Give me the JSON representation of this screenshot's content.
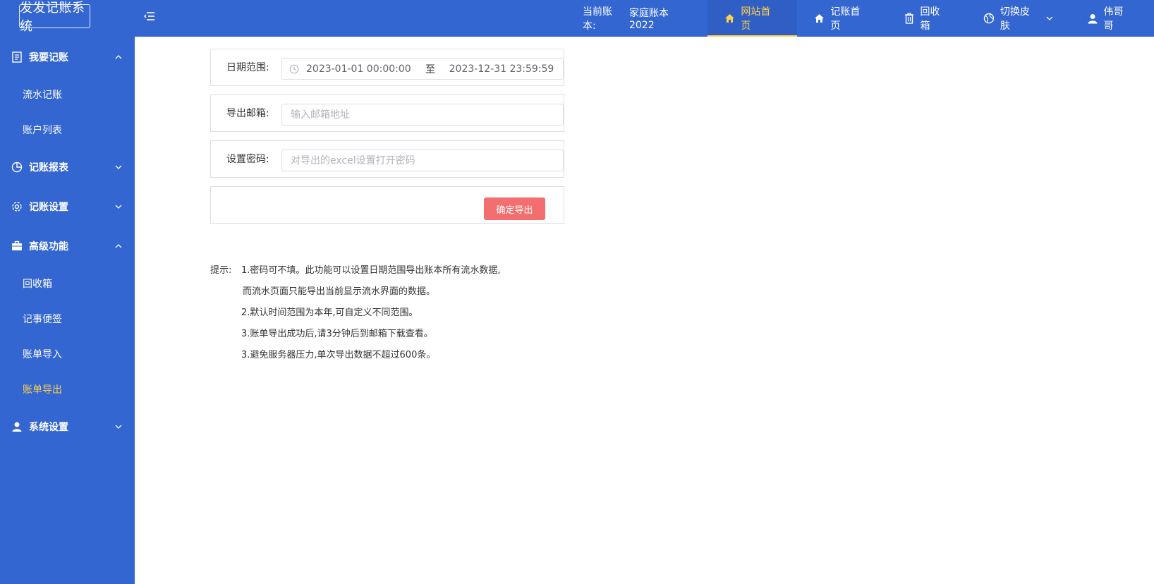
{
  "app": {
    "title": "发发记账系统"
  },
  "header": {
    "ledger_label": "当前账本:",
    "ledger_name": "家庭账本2022",
    "nav": [
      {
        "label": "网站首页",
        "icon": "home-icon",
        "active": true
      },
      {
        "label": "记账首页",
        "icon": "home-icon",
        "active": false
      },
      {
        "label": "回收箱",
        "icon": "trash-icon",
        "active": false
      },
      {
        "label": "切换皮肤",
        "icon": "palette-icon",
        "active": false
      },
      {
        "label": "伟哥哥",
        "icon": "user-icon",
        "active": false
      }
    ]
  },
  "sidebar": {
    "groups": [
      {
        "label": "我要记账",
        "icon": "document-icon",
        "expanded": true,
        "items": [
          {
            "label": "流水记账"
          },
          {
            "label": "账户列表"
          }
        ]
      },
      {
        "label": "记账报表",
        "icon": "pie-chart-icon",
        "expanded": false,
        "items": []
      },
      {
        "label": "记账设置",
        "icon": "gear-icon",
        "expanded": false,
        "items": []
      },
      {
        "label": "高级功能",
        "icon": "briefcase-icon",
        "expanded": true,
        "items": [
          {
            "label": "回收箱"
          },
          {
            "label": "记事便签"
          },
          {
            "label": "账单导入"
          },
          {
            "label": "账单导出",
            "active": true
          }
        ]
      },
      {
        "label": "系统设置",
        "icon": "user-icon",
        "expanded": false,
        "items": []
      }
    ]
  },
  "form": {
    "date_range": {
      "label": "日期范围:",
      "start": "2023-01-01 00:00:00",
      "separator": "至",
      "end": "2023-12-31 23:59:59"
    },
    "email": {
      "label": "导出邮箱:",
      "value": "",
      "placeholder": "输入邮箱地址"
    },
    "password": {
      "label": "设置密码:",
      "value": "",
      "placeholder": "对导出的excel设置打开密码"
    },
    "confirm_label": "确定导出"
  },
  "tips": {
    "label": "提示:",
    "lines": [
      "1.密码可不填。此功能可以设置日期范围导出账本所有流水数据,",
      " 而流水页面只能导出当前显示流水界面的数据。",
      "2.默认时间范围为本年,可自定义不同范围。",
      "3.账单导出成功后,请3分钟后到邮箱下载查看。",
      "3.避免服务器压力,单次导出数据不超过600条。"
    ]
  },
  "colors": {
    "primary": "#3366d1",
    "active": "#ffd04b",
    "button": "#f36e6e"
  }
}
